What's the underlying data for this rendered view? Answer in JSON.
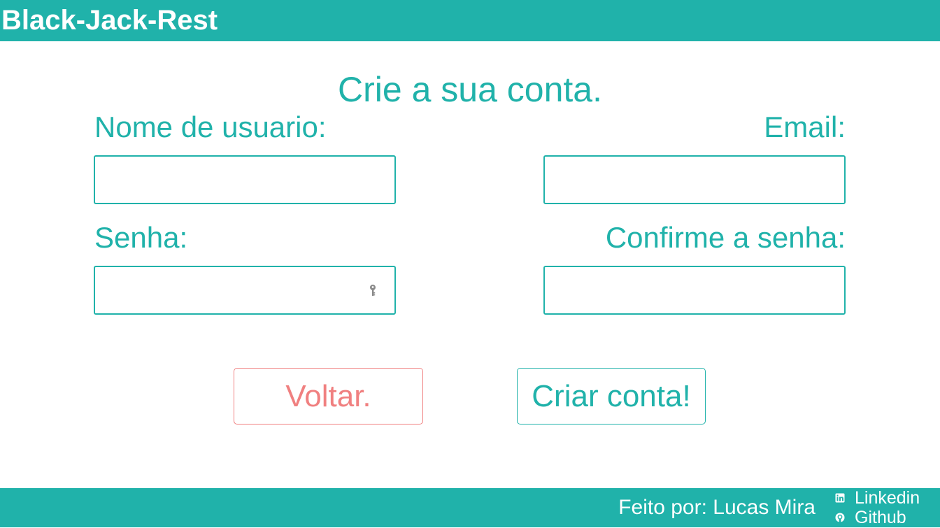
{
  "header": {
    "app_title": "Black-Jack-Rest"
  },
  "form": {
    "title": "Crie a sua conta.",
    "username_label": "Nome de usuario:",
    "email_label": "Email:",
    "password_label": "Senha:",
    "confirm_password_label": "Confirme a senha:",
    "username_value": "",
    "email_value": "",
    "password_value": "",
    "confirm_password_value": ""
  },
  "buttons": {
    "back_label": "Voltar.",
    "create_label": "Criar conta!"
  },
  "footer": {
    "credit": "Feito por: Lucas Mira",
    "linkedin_label": "Linkedin",
    "github_label": "Github"
  },
  "icons": {
    "password_field": "key-icon",
    "linkedin": "linkedin-icon",
    "github": "github-icon"
  },
  "colors": {
    "primary": "#20b2aa",
    "danger": "#f08080",
    "background": "#ffffff",
    "header_text": "#ffffff"
  }
}
